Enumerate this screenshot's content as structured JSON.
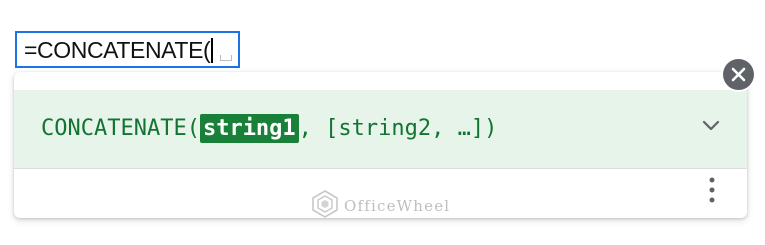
{
  "cell": {
    "formula": "=CONCATENATE("
  },
  "popup": {
    "function_name": "CONCATENATE(",
    "active_argument": "string1",
    "remaining_arguments": ", [string2, …])",
    "expand_icon": "chevron-down-icon",
    "more_icon": "more-vert-icon"
  },
  "close_icon": "close-icon",
  "watermark": {
    "text": "OfficeWheel"
  },
  "colors": {
    "cell_border": "#1a73e8",
    "header_bg": "#e6f4ea",
    "function_text": "#137333",
    "active_arg_bg": "#188038",
    "close_bg": "#5f6368"
  }
}
